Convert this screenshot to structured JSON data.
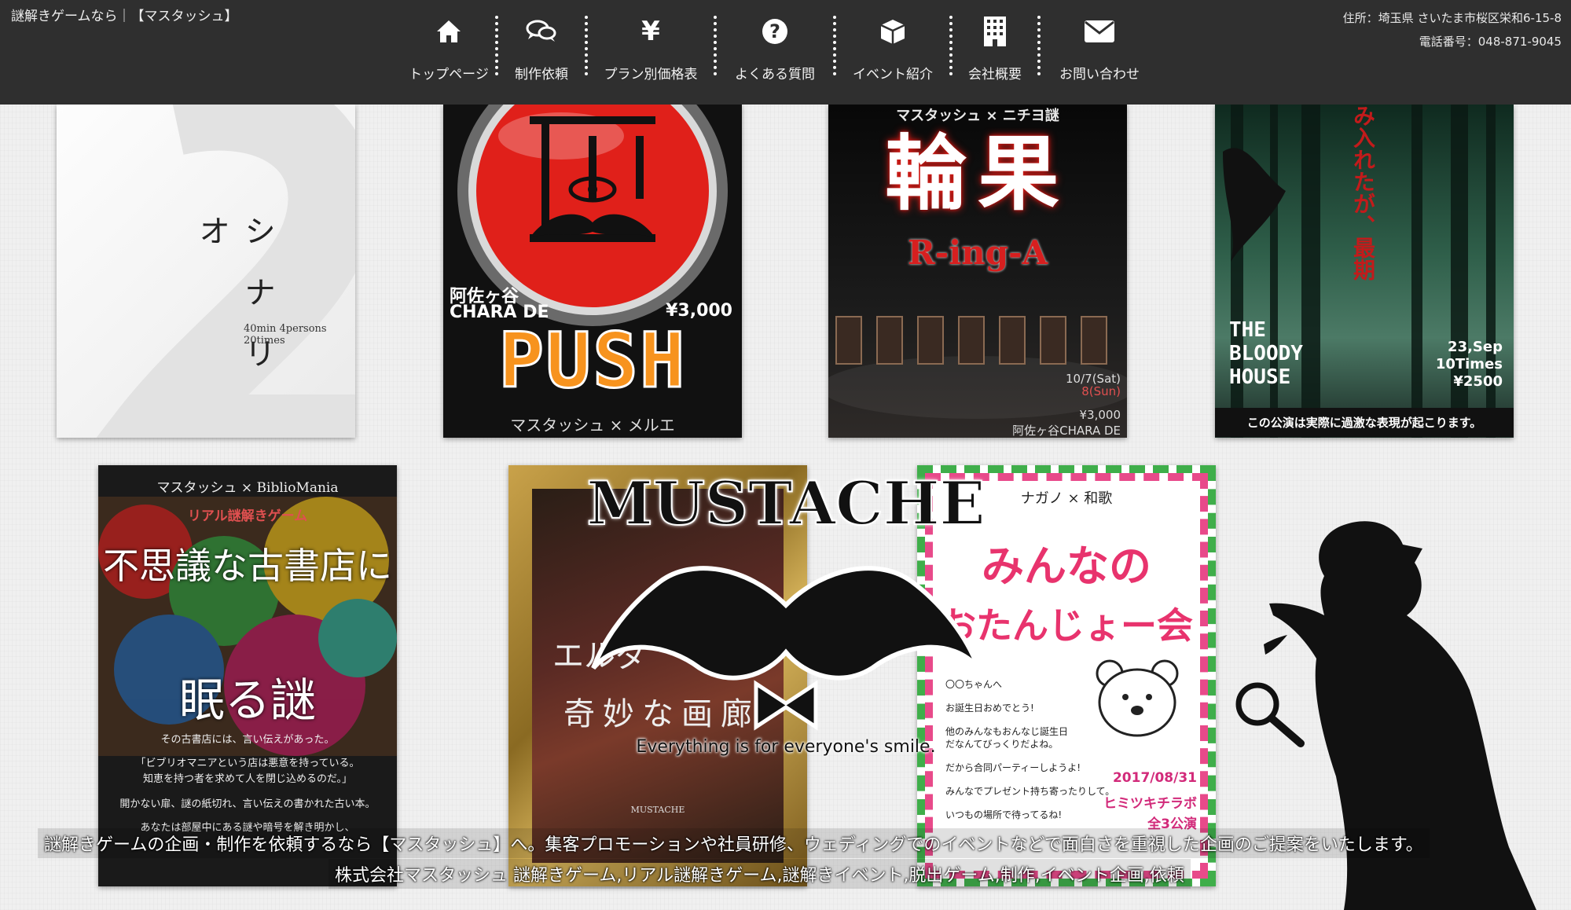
{
  "header": {
    "tagline": "謎解きゲームなら｜【マスタッシュ】",
    "address": "住所：埼玉県 さいたま市桜区栄和6-15-8",
    "phone": "電話番号：048-871-9045"
  },
  "nav": [
    {
      "label": "トップページ",
      "icon": "home-icon"
    },
    {
      "label": "制作依頼",
      "icon": "chat-icon"
    },
    {
      "label": "プラン別価格表",
      "icon": "yen-icon"
    },
    {
      "label": "よくある質問",
      "icon": "question-icon"
    },
    {
      "label": "イベント紹介",
      "icon": "box-icon"
    },
    {
      "label": "会社概要",
      "icon": "building-icon"
    },
    {
      "label": "お問い合わせ",
      "icon": "envelope-icon"
    }
  ],
  "posters": {
    "p1": {
      "title": "シナリオ",
      "meta": "40min 4persons 20times"
    },
    "p2": {
      "venue": "阿佐ヶ谷",
      "venue2": "CHARA DE",
      "price": "¥3,000",
      "title": "PUSH",
      "credit": "マスタッシュ × メルエ"
    },
    "p3": {
      "collab": "マスタッシュ × ニチヨ謎",
      "title": "輪果",
      "subtitle": "R-ing-A",
      "date1": "10/7(Sat)",
      "date2": "8(Sun)",
      "price": "¥3,000",
      "venue": "阿佐ヶ谷CHARA DE"
    },
    "p4": {
      "vtitle": "み入れたが、最期",
      "t1": "THE",
      "t2": "BLOODY",
      "t3": "HOUSE",
      "d1": "23,Sep",
      "d2": "10Times",
      "d3": "¥2500",
      "warn": "この公演は実際に過激な表現が起こります。"
    },
    "p5": {
      "collab": "マスタッシュ × BiblioMania",
      "genre": "リアル謎解きゲーム",
      "t1": "不思議な古書店に",
      "t2": "眠る謎",
      "l1": "その古書店には、言い伝えがあった。",
      "l2": "「ビブリオマニアという店は悪意を持っている。",
      "l3": "知恵を持つ者を求めて人を閉じ込めるのだ。」",
      "l4": "開かない扉、謎の紙切れ、言い伝えの書かれた古い本。",
      "l5": "あなたは部屋中にある謎や暗号を解き明かし、"
    },
    "p6": {
      "t1": "エルダ",
      "t2": "奇妙な画廊",
      "brand": "MUSTACHE"
    },
    "p7": {
      "collab": "ナガノ × 和歌",
      "t1": "みんなの",
      "t2": "おたんじょー会",
      "n1": "〇〇ちゃんへ",
      "n2": "お誕生日おめでとう!",
      "n3": "他のみんなもおんなじ誕生日",
      "n4": "だなんてびっくりだよね。",
      "n5": "だから合同パーティーしようよ!",
      "n6": "みんなでプレゼント持ち寄ったりして。",
      "n7": "いつもの場所で待ってるね!",
      "date": "2017/08/31",
      "place": "ヒミツキチラボ",
      "count": "全3公演"
    }
  },
  "logo": {
    "title": "MUSTACHE",
    "tagline": "Everything is for everyone's smile."
  },
  "overlay": {
    "line1": "謎解きゲームの企画・制作を依頼するなら【マスタッシュ】へ。集客プロモーションや社員研修、ウェディングでのイベントなどで面白さを重視した企画のご提案をいたします。",
    "line2": "株式会社マスタッシュ  謎解きゲーム,リアル謎解きゲーム,謎解きイベント,脱出ゲーム,制作,イベント企画,依頼"
  },
  "colors": {
    "header_bg": "#2f2f2f",
    "push_orange": "#f7931e",
    "push_red": "#e0201a"
  }
}
